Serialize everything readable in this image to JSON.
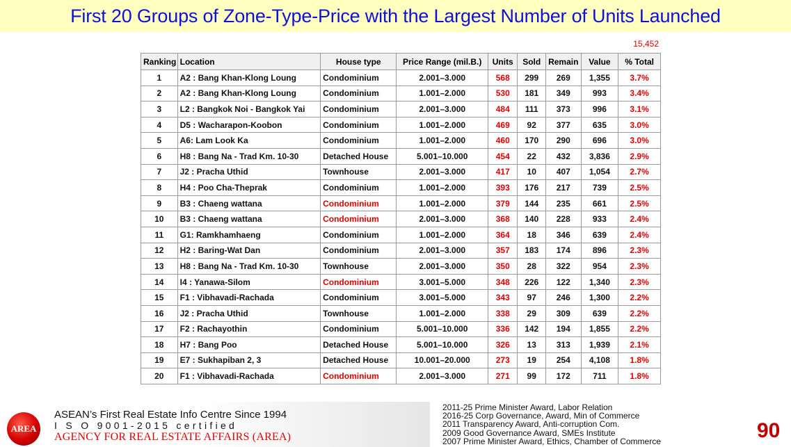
{
  "title": "First 20 Groups of Zone-Type-Price with the Largest Number of Units Launched",
  "total_units": "15,452",
  "table": {
    "headers": [
      "Ranking",
      "Location",
      "House type",
      "Price Range (mil.B.)",
      "Units",
      "Sold",
      "Remain",
      "Value",
      "% Total"
    ],
    "rows": [
      {
        "rank": "1",
        "location": "A2 : Bang Khan-Klong Loung",
        "type": "Condominium",
        "type_red": false,
        "price": "2.001–3.000",
        "units": "568",
        "sold": "299",
        "remain": "269",
        "value": "1,355",
        "pct": "3.7%"
      },
      {
        "rank": "2",
        "location": "A2 : Bang Khan-Klong Loung",
        "type": "Condominium",
        "type_red": false,
        "price": "1.001–2.000",
        "units": "530",
        "sold": "181",
        "remain": "349",
        "value": "993",
        "pct": "3.4%"
      },
      {
        "rank": "3",
        "location": "L2 : Bangkok Noi - Bangkok Yai",
        "type": "Condominium",
        "type_red": false,
        "price": "2.001–3.000",
        "units": "484",
        "sold": "111",
        "remain": "373",
        "value": "996",
        "pct": "3.1%"
      },
      {
        "rank": "4",
        "location": "D5 : Wacharapon-Koobon",
        "type": "Condominium",
        "type_red": false,
        "price": "1.001–2.000",
        "units": "469",
        "sold": "92",
        "remain": "377",
        "value": "635",
        "pct": "3.0%"
      },
      {
        "rank": "5",
        "location": "A6: Lam Look Ka",
        "type": "Condominium",
        "type_red": false,
        "price": "1.001–2.000",
        "units": "460",
        "sold": "170",
        "remain": "290",
        "value": "696",
        "pct": "3.0%"
      },
      {
        "rank": "6",
        "location": "H8 : Bang Na - Trad Km. 10-30",
        "type": "Detached House",
        "type_red": false,
        "price": "5.001–10.000",
        "units": "454",
        "sold": "22",
        "remain": "432",
        "value": "3,836",
        "pct": "2.9%"
      },
      {
        "rank": "7",
        "location": "J2 : Pracha Uthid",
        "type": "Townhouse",
        "type_red": false,
        "price": "2.001–3.000",
        "units": "417",
        "sold": "10",
        "remain": "407",
        "value": "1,054",
        "pct": "2.7%"
      },
      {
        "rank": "8",
        "location": "H4 : Poo Cha-Theprak",
        "type": "Condominium",
        "type_red": false,
        "price": "1.001–2.000",
        "units": "393",
        "sold": "176",
        "remain": "217",
        "value": "739",
        "pct": "2.5%"
      },
      {
        "rank": "9",
        "location": "B3 : Chaeng wattana",
        "type": "Condominium",
        "type_red": true,
        "price": "1.001–2.000",
        "units": "379",
        "sold": "144",
        "remain": "235",
        "value": "661",
        "pct": "2.5%"
      },
      {
        "rank": "10",
        "location": "B3 : Chaeng wattana",
        "type": "Condominium",
        "type_red": true,
        "price": "2.001–3.000",
        "units": "368",
        "sold": "140",
        "remain": "228",
        "value": "933",
        "pct": "2.4%"
      },
      {
        "rank": "11",
        "location": "G1: Ramkhamhaeng",
        "type": "Condominium",
        "type_red": false,
        "price": "1.001–2.000",
        "units": "364",
        "sold": "18",
        "remain": "346",
        "value": "639",
        "pct": "2.4%"
      },
      {
        "rank": "12",
        "location": "H2 : Baring-Wat Dan",
        "type": "Condominium",
        "type_red": false,
        "price": "2.001–3.000",
        "units": "357",
        "sold": "183",
        "remain": "174",
        "value": "896",
        "pct": "2.3%"
      },
      {
        "rank": "13",
        "location": "H8 : Bang Na - Trad Km. 10-30",
        "type": "Townhouse",
        "type_red": false,
        "price": "2.001–3.000",
        "units": "350",
        "sold": "28",
        "remain": "322",
        "value": "954",
        "pct": "2.3%"
      },
      {
        "rank": "14",
        "location": "I4 : Yanawa-Silom",
        "type": "Condominium",
        "type_red": true,
        "price": "3.001–5.000",
        "units": "348",
        "sold": "226",
        "remain": "122",
        "value": "1,340",
        "pct": "2.3%"
      },
      {
        "rank": "15",
        "location": "F1 : Vibhavadi-Rachada",
        "type": "Condominium",
        "type_red": false,
        "price": "3.001–5.000",
        "units": "343",
        "sold": "97",
        "remain": "246",
        "value": "1,300",
        "pct": "2.2%"
      },
      {
        "rank": "16",
        "location": "J2 : Pracha Uthid",
        "type": "Townhouse",
        "type_red": false,
        "price": "1.001–2.000",
        "units": "338",
        "sold": "29",
        "remain": "309",
        "value": "639",
        "pct": "2.2%"
      },
      {
        "rank": "17",
        "location": "F2 : Rachayothin",
        "type": "Condominium",
        "type_red": false,
        "price": "5.001–10.000",
        "units": "336",
        "sold": "142",
        "remain": "194",
        "value": "1,855",
        "pct": "2.2%"
      },
      {
        "rank": "18",
        "location": "H7 : Bang Poo",
        "type": "Detached House",
        "type_red": false,
        "price": "5.001–10.000",
        "units": "326",
        "sold": "13",
        "remain": "313",
        "value": "1,939",
        "pct": "2.1%"
      },
      {
        "rank": "19",
        "location": "E7 : Sukhapiban 2, 3",
        "type": "Detached House",
        "type_red": false,
        "price": "10.001–20.000",
        "units": "273",
        "sold": "19",
        "remain": "254",
        "value": "4,108",
        "pct": "1.8%"
      },
      {
        "rank": "20",
        "location": "F1 : Vibhavadi-Rachada",
        "type": "Condominium",
        "type_red": true,
        "price": "2.001–3.000",
        "units": "271",
        "sold": "99",
        "remain": "172",
        "value": "711",
        "pct": "1.8%"
      }
    ]
  },
  "footer": {
    "logo_text": "AREA",
    "line1": "ASEAN’s First Real Estate Info Centre Since 1994",
    "line2": "I S O 9001-2015 certified",
    "line3": "AGENCY FOR REAL ESTATE AFFAIRS (AREA)",
    "awards": [
      "2011-25 Prime Minister Award, Labor Relation",
      "2016-25 Corp Governance, Award, Min of Commerce",
      "2011 Transparency Award, Anti-corruption Com.",
      "2009 Good Governance Award, SMEs Institute",
      "2007 Prime Minister Award, Ethics, Chamber of Commerce"
    ],
    "page_number": "90"
  },
  "colors": {
    "title": "#1010d8",
    "title_bg": "#ffffbf",
    "accent_red": "#e00000",
    "page_number": "#c00000"
  }
}
